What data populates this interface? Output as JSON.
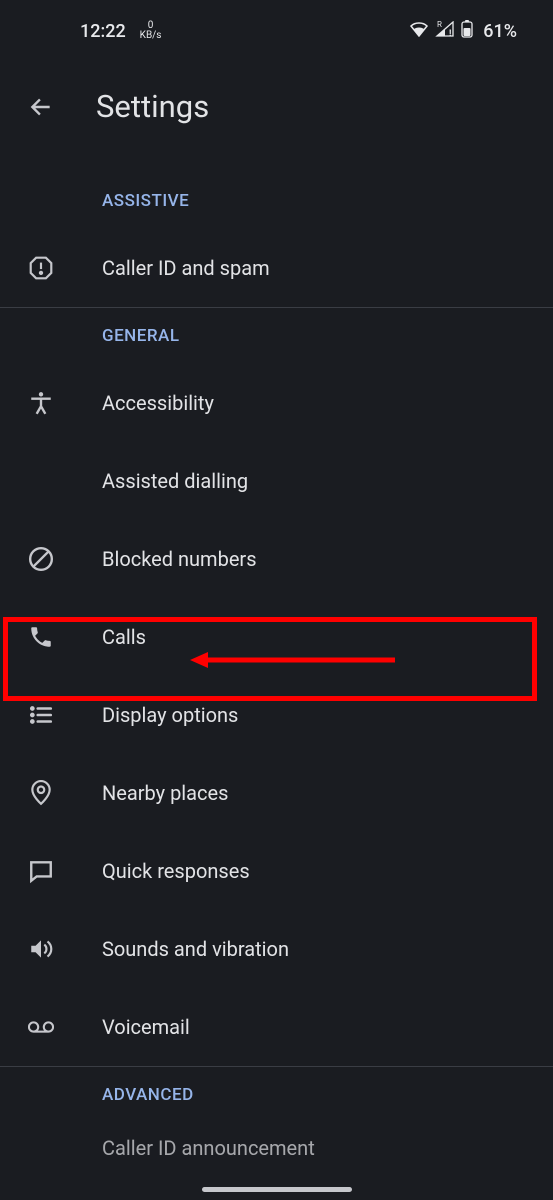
{
  "status_bar": {
    "time": "12:22",
    "kbs_value": "0",
    "kbs_unit": "KB/s",
    "battery_percent": "61%"
  },
  "app_bar": {
    "title": "Settings"
  },
  "sections": {
    "assistive": {
      "header": "ASSISTIVE",
      "items": [
        {
          "label": "Caller ID and spam"
        }
      ]
    },
    "general": {
      "header": "GENERAL",
      "items": [
        {
          "label": "Accessibility"
        },
        {
          "label": "Assisted dialling"
        },
        {
          "label": "Blocked numbers"
        },
        {
          "label": "Calls"
        },
        {
          "label": "Display options"
        },
        {
          "label": "Nearby places"
        },
        {
          "label": "Quick responses"
        },
        {
          "label": "Sounds and vibration"
        },
        {
          "label": "Voicemail"
        }
      ]
    },
    "advanced": {
      "header": "ADVANCED",
      "cutoff_item": "Caller ID announcement"
    }
  },
  "annotation": {
    "highlight_color": "#ff0000"
  }
}
